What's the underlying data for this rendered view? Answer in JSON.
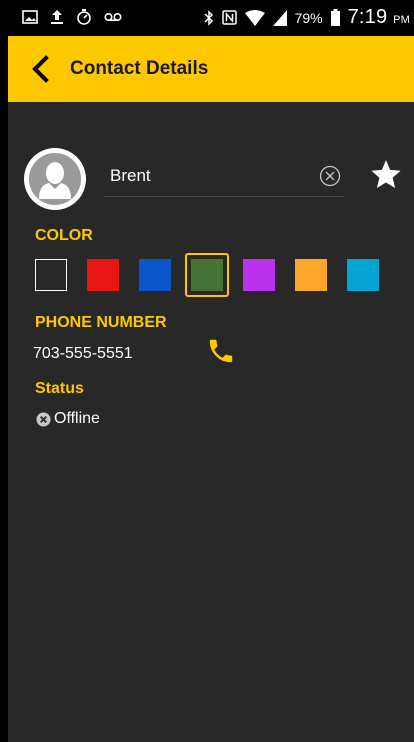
{
  "status_bar": {
    "battery": "79%",
    "time": "7:19",
    "ampm": "PM",
    "left_icons": [
      "image-icon",
      "upload-icon",
      "stopwatch-icon",
      "voicemail-icon"
    ],
    "right_icons": [
      "bluetooth-icon",
      "nfc-icon",
      "wifi-icon",
      "signal-icon",
      "battery-icon"
    ]
  },
  "header": {
    "title": "Contact Details",
    "background_color": "#fdc800"
  },
  "contact": {
    "name": "Brent",
    "favorite": true
  },
  "color_section": {
    "label": "COLOR",
    "swatches": [
      "#282828",
      "#e81515",
      "#0b56c9",
      "#477434",
      "#b932ec",
      "#fda62c",
      "#03a4d1"
    ],
    "selected_index": 3
  },
  "phone_section": {
    "label": "PHONE NUMBER",
    "number": "703-555-5551"
  },
  "status_section": {
    "label": "Status",
    "value": "Offline"
  },
  "accent_color": "#fdc800"
}
